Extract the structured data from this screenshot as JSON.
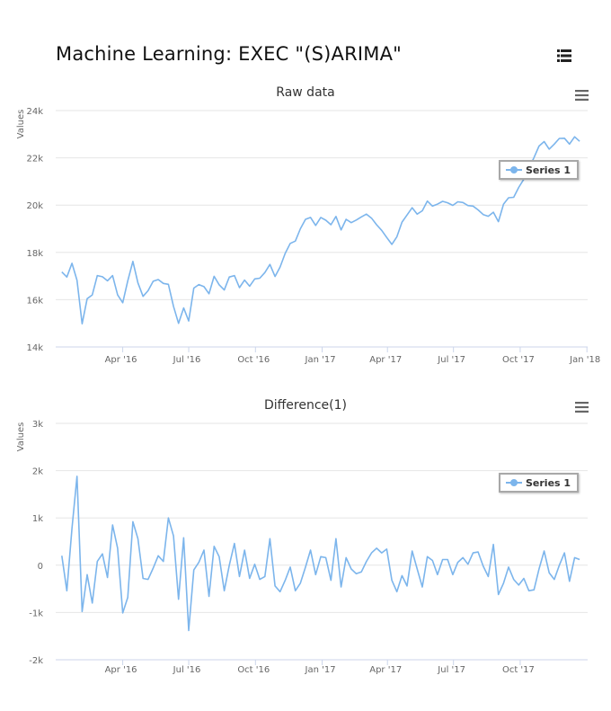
{
  "page": {
    "title": "Machine Learning: EXEC \"(S)ARIMA\"",
    "list_icon": "list-icon",
    "menu_icon": "hamburger-menu-icon"
  },
  "colors": {
    "series": "#7cb5ec",
    "grid": "#e6e6e6",
    "axis_text": "#666666"
  },
  "chart_data": [
    {
      "type": "line",
      "title": "Raw data",
      "xlabel": "",
      "ylabel": "Values",
      "ylim": [
        14000,
        24000
      ],
      "yticks": [
        14000,
        16000,
        18000,
        20000,
        22000,
        24000
      ],
      "ytick_labels": [
        "14k",
        "16k",
        "18k",
        "20k",
        "22k",
        "24k"
      ],
      "xticks": [
        "2016-04-01",
        "2016-07-01",
        "2016-10-01",
        "2017-01-01",
        "2017-04-01",
        "2017-07-01",
        "2017-10-01",
        "2018-01-01"
      ],
      "xtick_labels": [
        "Apr '16",
        "Jul '16",
        "Oct '16",
        "Jan '17",
        "Apr '17",
        "Jul '17",
        "Oct '17",
        "Jan '18"
      ],
      "legend": "right",
      "grid": true,
      "x": [
        "2016-01-08",
        "2016-01-15",
        "2016-01-22",
        "2016-01-29",
        "2016-02-05",
        "2016-02-12",
        "2016-02-19",
        "2016-02-26",
        "2016-03-04",
        "2016-03-11",
        "2016-03-18",
        "2016-03-25",
        "2016-04-01",
        "2016-04-08",
        "2016-04-15",
        "2016-04-22",
        "2016-04-29",
        "2016-05-06",
        "2016-05-13",
        "2016-05-20",
        "2016-05-27",
        "2016-06-03",
        "2016-06-10",
        "2016-06-17",
        "2016-06-24",
        "2016-07-01",
        "2016-07-08",
        "2016-07-15",
        "2016-07-22",
        "2016-07-29",
        "2016-08-05",
        "2016-08-12",
        "2016-08-19",
        "2016-08-26",
        "2016-09-02",
        "2016-09-09",
        "2016-09-16",
        "2016-09-23",
        "2016-09-30",
        "2016-10-07",
        "2016-10-14",
        "2016-10-21",
        "2016-10-28",
        "2016-11-04",
        "2016-11-11",
        "2016-11-18",
        "2016-11-25",
        "2016-12-02",
        "2016-12-09",
        "2016-12-16",
        "2016-12-23",
        "2016-12-30",
        "2017-01-06",
        "2017-01-13",
        "2017-01-20",
        "2017-01-27",
        "2017-02-03",
        "2017-02-10",
        "2017-02-17",
        "2017-02-24",
        "2017-03-03",
        "2017-03-10",
        "2017-03-17",
        "2017-03-24",
        "2017-03-31",
        "2017-04-07",
        "2017-04-14",
        "2017-04-21",
        "2017-04-28",
        "2017-05-05",
        "2017-05-12",
        "2017-05-19",
        "2017-05-26",
        "2017-06-02",
        "2017-06-09",
        "2017-06-16",
        "2017-06-23",
        "2017-06-30",
        "2017-07-07",
        "2017-07-14",
        "2017-07-21",
        "2017-07-28",
        "2017-08-04",
        "2017-08-11",
        "2017-08-18",
        "2017-08-25",
        "2017-09-01",
        "2017-09-08",
        "2017-09-15",
        "2017-09-22",
        "2017-09-29",
        "2017-10-06",
        "2017-10-13",
        "2017-10-20",
        "2017-10-27",
        "2017-11-03",
        "2017-11-10",
        "2017-11-17",
        "2017-11-24",
        "2017-12-01",
        "2017-12-08",
        "2017-12-15",
        "2017-12-22",
        "2017-12-29"
      ],
      "series": [
        {
          "name": "Series 1",
          "values": [
            17170,
            16960,
            17540,
            16820,
            14980,
            16040,
            16200,
            17020,
            16970,
            16800,
            17020,
            16200,
            15870,
            16800,
            17620,
            16710,
            16140,
            16380,
            16780,
            16850,
            16690,
            16650,
            15720,
            15000,
            15650,
            15100,
            16490,
            16640,
            16550,
            16250,
            16990,
            16630,
            16410,
            16960,
            17020,
            16510,
            16830,
            16570,
            16880,
            16910,
            17150,
            17490,
            16980,
            17380,
            17960,
            18380,
            18480,
            19000,
            19400,
            19480,
            19140,
            19480,
            19360,
            19170,
            19520,
            18950,
            19400,
            19260,
            19370,
            19500,
            19620,
            19450,
            19170,
            18930,
            18630,
            18340,
            18660,
            19280,
            19580,
            19890,
            19620,
            19760,
            20170,
            19960,
            20040,
            20160,
            20100,
            19990,
            20140,
            20110,
            19980,
            19960,
            19800,
            19600,
            19530,
            19700,
            19300,
            20040,
            20310,
            20330,
            20750,
            21100,
            21550,
            22010,
            22500,
            22690,
            22370,
            22580,
            22820,
            22830,
            22580,
            22890,
            22700
          ]
        }
      ]
    },
    {
      "type": "line",
      "title": "Difference(1)",
      "xlabel": "",
      "ylabel": "Values",
      "ylim": [
        -2000,
        3000
      ],
      "yticks": [
        -2000,
        -1000,
        0,
        1000,
        2000,
        3000
      ],
      "ytick_labels": [
        "-2k",
        "-1k",
        "0",
        "1k",
        "2k",
        "3k"
      ],
      "xticks": [
        "2016-04-01",
        "2016-07-01",
        "2016-10-01",
        "2017-01-01",
        "2017-04-01",
        "2017-07-01",
        "2017-10-01"
      ],
      "xtick_labels": [
        "Apr '16",
        "Jul '16",
        "Oct '16",
        "Jan '17",
        "Apr '17",
        "Jul '17",
        "Oct '17"
      ],
      "legend": "right",
      "grid": true,
      "x": [
        "2016-01-08",
        "2016-01-15",
        "2016-01-22",
        "2016-01-29",
        "2016-02-05",
        "2016-02-12",
        "2016-02-19",
        "2016-02-26",
        "2016-03-04",
        "2016-03-11",
        "2016-03-18",
        "2016-03-25",
        "2016-04-01",
        "2016-04-08",
        "2016-04-15",
        "2016-04-22",
        "2016-04-29",
        "2016-05-06",
        "2016-05-13",
        "2016-05-20",
        "2016-05-27",
        "2016-06-03",
        "2016-06-10",
        "2016-06-17",
        "2016-06-24",
        "2016-07-01",
        "2016-07-08",
        "2016-07-15",
        "2016-07-22",
        "2016-07-29",
        "2016-08-05",
        "2016-08-12",
        "2016-08-19",
        "2016-08-26",
        "2016-09-02",
        "2016-09-09",
        "2016-09-16",
        "2016-09-23",
        "2016-09-30",
        "2016-10-07",
        "2016-10-14",
        "2016-10-21",
        "2016-10-28",
        "2016-11-04",
        "2016-11-11",
        "2016-11-18",
        "2016-11-25",
        "2016-12-02",
        "2016-12-09",
        "2016-12-16",
        "2016-12-23",
        "2016-12-30",
        "2017-01-06",
        "2017-01-13",
        "2017-01-20",
        "2017-01-27",
        "2017-02-03",
        "2017-02-10",
        "2017-02-17",
        "2017-02-24",
        "2017-03-03",
        "2017-03-10",
        "2017-03-17",
        "2017-03-24",
        "2017-03-31",
        "2017-04-07",
        "2017-04-14",
        "2017-04-21",
        "2017-04-28",
        "2017-05-05",
        "2017-05-12",
        "2017-05-19",
        "2017-05-26",
        "2017-06-02",
        "2017-06-09",
        "2017-06-16",
        "2017-06-23",
        "2017-06-30",
        "2017-07-07",
        "2017-07-14",
        "2017-07-21",
        "2017-07-28",
        "2017-08-04",
        "2017-08-11",
        "2017-08-18",
        "2017-08-25",
        "2017-09-01",
        "2017-09-08",
        "2017-09-15",
        "2017-09-22",
        "2017-09-29",
        "2017-10-06",
        "2017-10-13",
        "2017-10-20",
        "2017-10-27",
        "2017-11-03",
        "2017-11-10",
        "2017-11-17",
        "2017-11-24",
        "2017-12-01",
        "2017-12-08",
        "2017-12-15",
        "2017-12-22",
        "2017-12-29"
      ],
      "series": [
        {
          "name": "Series 1",
          "values": [
            200,
            -540,
            780,
            1880,
            -980,
            -200,
            -800,
            80,
            240,
            -260,
            850,
            360,
            -1010,
            -680,
            920,
            560,
            -280,
            -300,
            -60,
            200,
            80,
            1000,
            620,
            -720,
            580,
            -1380,
            -100,
            60,
            320,
            -660,
            400,
            180,
            -540,
            0,
            460,
            -240,
            320,
            -280,
            20,
            -300,
            -240,
            560,
            -440,
            -560,
            -320,
            -40,
            -540,
            -380,
            -40,
            320,
            -200,
            180,
            160,
            -320,
            560,
            -460,
            160,
            -80,
            -180,
            -140,
            80,
            260,
            360,
            260,
            340,
            -320,
            -560,
            -220,
            -440,
            300,
            -80,
            -460,
            180,
            100,
            -200,
            120,
            120,
            -200,
            60,
            160,
            20,
            260,
            280,
            -20,
            -240,
            440,
            -620,
            -380,
            -40,
            -300,
            -420,
            -280,
            -540,
            -520,
            -80,
            300,
            -160,
            -300,
            0,
            260,
            -340,
            160,
            120
          ]
        }
      ]
    }
  ],
  "legend": {
    "label": "Series 1"
  }
}
